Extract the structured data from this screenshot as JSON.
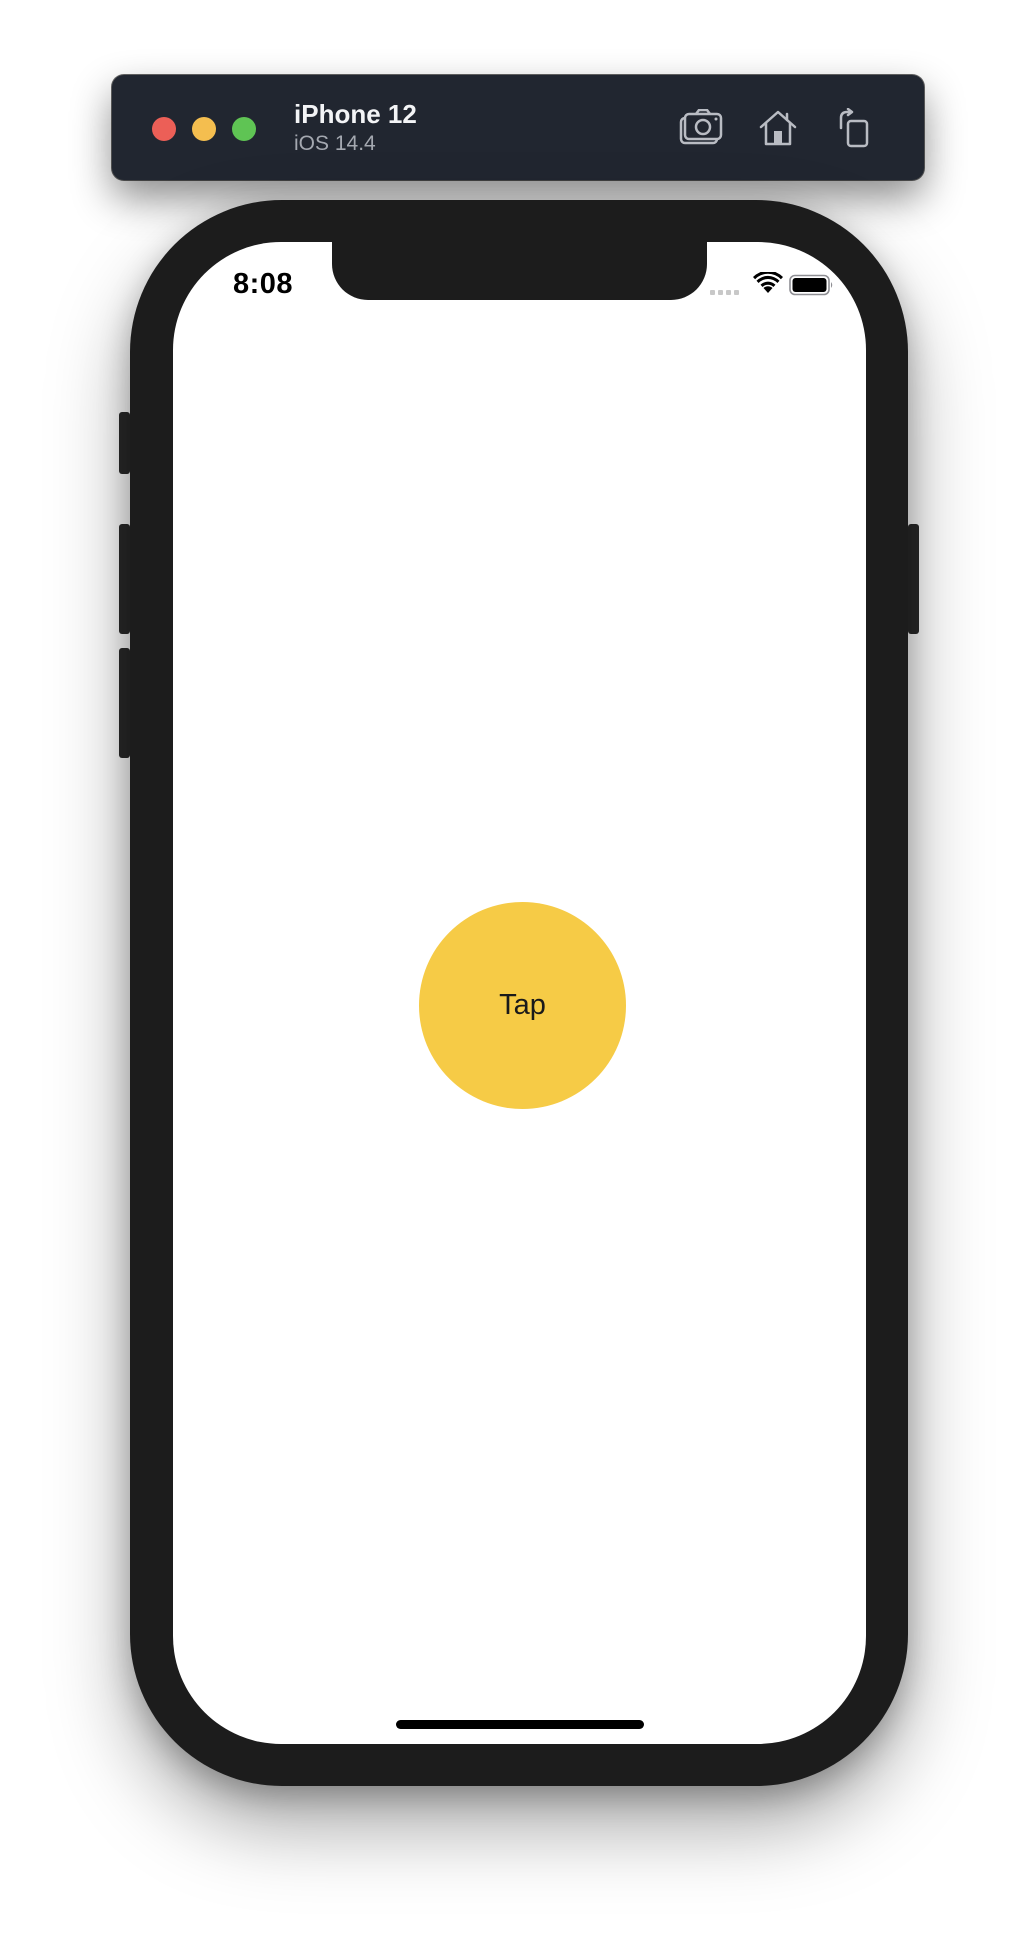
{
  "simulator": {
    "device_name": "iPhone 12",
    "os_version": "iOS 14.4",
    "toolbar": {
      "screenshot_icon": "camera-screenshot-icon",
      "home_icon": "home-icon",
      "rotate_icon": "rotate-icon"
    },
    "traffic_lights": {
      "close_color": "#ec5f57",
      "minimize_color": "#f4be4f",
      "zoom_color": "#5fc454"
    }
  },
  "status_bar": {
    "time": "8:08",
    "wifi_icon": "wifi-icon",
    "battery_icon": "battery-icon"
  },
  "app": {
    "button_label": "Tap",
    "button_color": "#f6cb46"
  }
}
